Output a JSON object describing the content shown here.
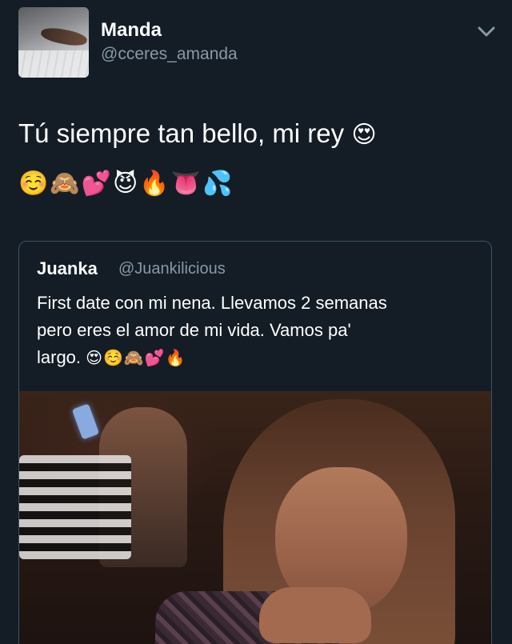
{
  "author": {
    "display_name": "Manda",
    "handle": "@cceres_amanda"
  },
  "header": {
    "menu_icon": "chevron-down-icon"
  },
  "tweet": {
    "text": "Tú siempre tan bello, mi rey",
    "text_emoji": "😍",
    "emoji_line": "☺️🙈💕😈🔥👅💦"
  },
  "quoted_tweet": {
    "display_name": "Juanka",
    "handle": "@Juankilicious",
    "line1": "First date con mi nena. Llevamos 2 semanas",
    "line2": "pero eres el amor de mi vida. Vamos pa'",
    "line3": "largo.",
    "emojis": "😍☺️🙈💕🔥",
    "media": "photo"
  },
  "colors": {
    "background": "#141d26",
    "secondary_text": "#8899a6",
    "card_border": "#3d5466"
  }
}
